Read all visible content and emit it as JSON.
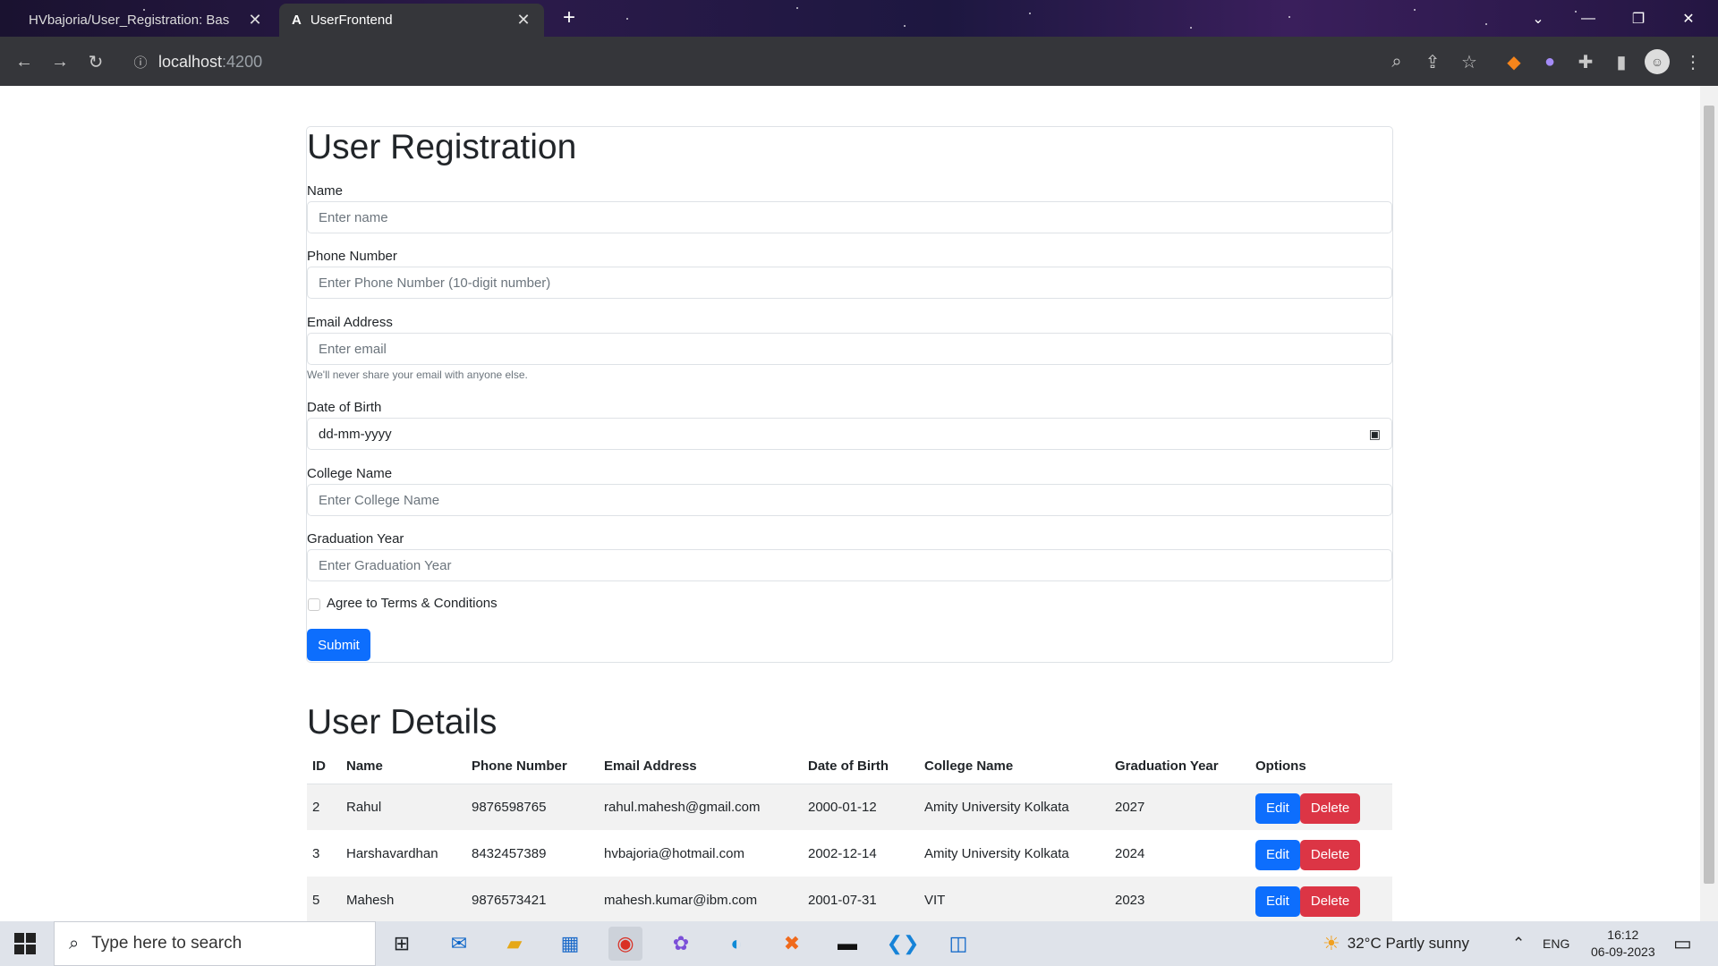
{
  "browser": {
    "tabs": [
      {
        "title": "HVbajoria/User_Registration: Bas",
        "active": false
      },
      {
        "title": "UserFrontend",
        "active": true
      }
    ],
    "url_host": "localhost",
    "url_port": ":4200"
  },
  "form": {
    "title": "User Registration",
    "name_label": "Name",
    "name_placeholder": "Enter name",
    "phone_label": "Phone Number",
    "phone_placeholder": "Enter Phone Number (10-digit number)",
    "email_label": "Email Address",
    "email_placeholder": "Enter email",
    "email_help": "We'll never share your email with anyone else.",
    "dob_label": "Date of Birth",
    "dob_value": "dd-mm-yyyy",
    "college_label": "College Name",
    "college_placeholder": "Enter College Name",
    "grad_label": "Graduation Year",
    "grad_placeholder": "Enter Graduation Year",
    "terms_label": "Agree to Terms & Conditions",
    "submit_label": "Submit"
  },
  "details": {
    "title": "User Details",
    "headers": [
      "ID",
      "Name",
      "Phone Number",
      "Email Address",
      "Date of Birth",
      "College Name",
      "Graduation Year",
      "Options"
    ],
    "rows": [
      [
        "2",
        "Rahul",
        "9876598765",
        "rahul.mahesh@gmail.com",
        "2000-01-12",
        "Amity University Kolkata",
        "2027"
      ],
      [
        "3",
        "Harshavardhan",
        "8432457389",
        "hvbajoria@hotmail.com",
        "2002-12-14",
        "Amity University Kolkata",
        "2024"
      ],
      [
        "5",
        "Mahesh",
        "9876573421",
        "mahesh.kumar@ibm.com",
        "2001-07-31",
        "VIT",
        "2023"
      ]
    ],
    "edit_label": "Edit",
    "delete_label": "Delete"
  },
  "taskbar": {
    "search_text": "Type here to search",
    "weather": "32°C  Partly sunny",
    "lang": "ENG",
    "time": "16:12",
    "date": "06-09-2023"
  },
  "colors": {
    "primary": "#0d6efd",
    "danger": "#dc3545",
    "chrome": "#35363a"
  }
}
